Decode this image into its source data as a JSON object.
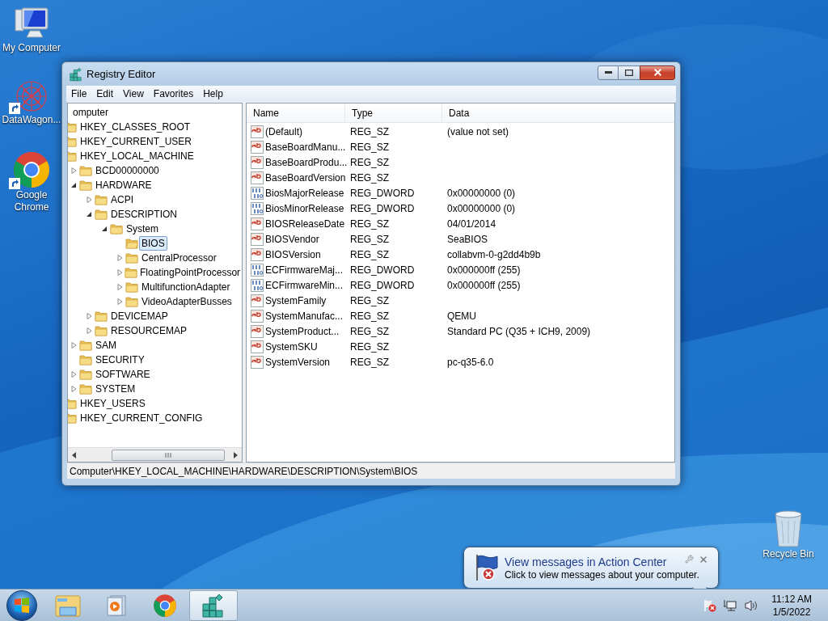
{
  "desktop": {
    "icons": [
      {
        "label": "My Computer",
        "kind": "computer"
      },
      {
        "label": "DataWagon...",
        "kind": "datawagon",
        "shortcut": true
      },
      {
        "label": "Google Chrome",
        "kind": "chrome",
        "shortcut": true
      }
    ],
    "recycle_bin": {
      "label": "Recycle Bin"
    }
  },
  "window": {
    "title": "Registry Editor",
    "menu": [
      "File",
      "Edit",
      "View",
      "Favorites",
      "Help"
    ],
    "tree": [
      {
        "label": "omputer",
        "selected": false,
        "children": [
          {
            "label": "HKEY_CLASSES_ROOT",
            "selected": false
          },
          {
            "label": "HKEY_CURRENT_USER",
            "selected": false
          },
          {
            "label": "HKEY_LOCAL_MACHINE",
            "selected": false,
            "children": [
              {
                "label": "BCD00000000",
                "expanded": false,
                "selected": false
              },
              {
                "label": "HARDWARE",
                "expanded": true,
                "selected": false,
                "children": [
                  {
                    "label": "ACPI",
                    "expanded": false,
                    "selected": false
                  },
                  {
                    "label": "DESCRIPTION",
                    "expanded": true,
                    "selected": false,
                    "children": [
                      {
                        "label": "System",
                        "expanded": true,
                        "selected": false,
                        "children": [
                          {
                            "label": "BIOS",
                            "selected": true
                          },
                          {
                            "label": "CentralProcessor",
                            "expanded": false,
                            "selected": false
                          },
                          {
                            "label": "FloatingPointProcessor",
                            "expanded": false,
                            "selected": false
                          },
                          {
                            "label": "MultifunctionAdapter",
                            "expanded": false,
                            "selected": false
                          },
                          {
                            "label": "VideoAdapterBusses",
                            "expanded": false,
                            "selected": false
                          }
                        ]
                      }
                    ]
                  },
                  {
                    "label": "DEVICEMAP",
                    "expanded": false,
                    "selected": false
                  },
                  {
                    "label": "RESOURCEMAP",
                    "expanded": false,
                    "selected": false
                  }
                ]
              },
              {
                "label": "SAM",
                "expanded": false,
                "selected": false
              },
              {
                "label": "SECURITY",
                "selected": false
              },
              {
                "label": "SOFTWARE",
                "expanded": false,
                "selected": false
              },
              {
                "label": "SYSTEM",
                "expanded": false,
                "selected": false
              }
            ]
          },
          {
            "label": "HKEY_USERS",
            "selected": false
          },
          {
            "label": "HKEY_CURRENT_CONFIG",
            "selected": false
          }
        ]
      }
    ],
    "columns": [
      "Name",
      "Type",
      "Data"
    ],
    "values": [
      {
        "kind": "string",
        "name": "(Default)",
        "type": "REG_SZ",
        "data": "(value not set)"
      },
      {
        "kind": "string",
        "name": "BaseBoardManu...",
        "type": "REG_SZ"
      },
      {
        "kind": "string",
        "name": "BaseBoardProdu...",
        "type": "REG_SZ"
      },
      {
        "kind": "string",
        "name": "BaseBoardVersion",
        "type": "REG_SZ"
      },
      {
        "kind": "binary",
        "name": "BiosMajorRelease",
        "type": "REG_DWORD",
        "data": "0x00000000 (0)"
      },
      {
        "kind": "binary",
        "name": "BiosMinorRelease",
        "type": "REG_DWORD",
        "data": "0x00000000 (0)"
      },
      {
        "kind": "string",
        "name": "BIOSReleaseDate",
        "type": "REG_SZ",
        "data": "04/01/2014"
      },
      {
        "kind": "string",
        "name": "BIOSVendor",
        "type": "REG_SZ",
        "data": "SeaBIOS"
      },
      {
        "kind": "string",
        "name": "BIOSVersion",
        "type": "REG_SZ",
        "data": "collabvm-0-g2dd4b9b"
      },
      {
        "kind": "binary",
        "name": "ECFirmwareMaj...",
        "type": "REG_DWORD",
        "data": "0x000000ff (255)"
      },
      {
        "kind": "binary",
        "name": "ECFirmwareMin...",
        "type": "REG_DWORD",
        "data": "0x000000ff (255)"
      },
      {
        "kind": "string",
        "name": "SystemFamily",
        "type": "REG_SZ"
      },
      {
        "kind": "string",
        "name": "SystemManufac...",
        "type": "REG_SZ",
        "data": "QEMU"
      },
      {
        "kind": "string",
        "name": "SystemProduct...",
        "type": "REG_SZ",
        "data": "Standard PC (Q35 + ICH9, 2009)"
      },
      {
        "kind": "string",
        "name": "SystemSKU",
        "type": "REG_SZ"
      },
      {
        "kind": "string",
        "name": "SystemVersion",
        "type": "REG_SZ",
        "data": "pc-q35-6.0"
      }
    ],
    "status_bar": "Computer\\HKEY_LOCAL_MACHINE\\HARDWARE\\DESCRIPTION\\System\\BIOS"
  },
  "notification": {
    "title": "View messages in Action Center",
    "text": "Click to view messages about your computer."
  },
  "taskbar": {
    "apps": [
      {
        "kind": "explorer",
        "active": false
      },
      {
        "kind": "media",
        "active": false
      },
      {
        "kind": "chrome",
        "active": false
      },
      {
        "kind": "regedit",
        "active": true
      }
    ],
    "clock": {
      "time": "11:12 AM",
      "date": "1/5/2022"
    }
  }
}
